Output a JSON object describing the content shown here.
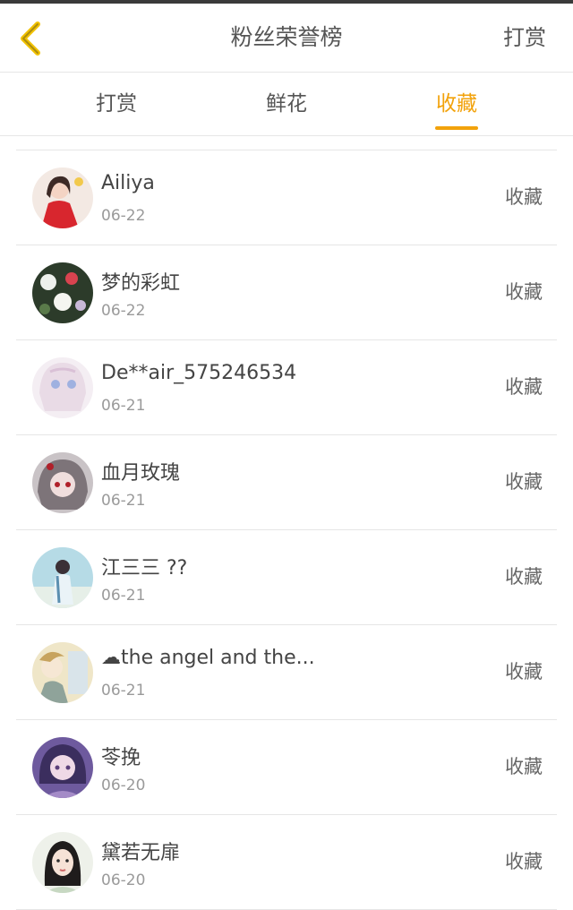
{
  "header": {
    "title": "粉丝荣誉榜",
    "action_label": "打赏",
    "back_icon": "chevron-left-icon",
    "back_color": "#f2c200"
  },
  "tabs": [
    {
      "label": "打赏",
      "active": false
    },
    {
      "label": "鲜花",
      "active": false
    },
    {
      "label": "收藏",
      "active": true
    }
  ],
  "accent_color": "#f2a20b",
  "fans": [
    {
      "name": "Ailiya",
      "date": "06-22",
      "action": "收藏"
    },
    {
      "name": "梦的彩虹",
      "date": "06-22",
      "action": "收藏"
    },
    {
      "name": "De**air_575246534",
      "date": "06-21",
      "action": "收藏"
    },
    {
      "name": "血月玫瑰",
      "date": "06-21",
      "action": "收藏"
    },
    {
      "name": "江三三 ??",
      "date": "06-21",
      "action": "收藏"
    },
    {
      "name": "☁the angel and the...",
      "date": "06-21",
      "action": "收藏"
    },
    {
      "name": "苓挽",
      "date": "06-20",
      "action": "收藏"
    },
    {
      "name": "黛若无扉",
      "date": "06-20",
      "action": "收藏"
    }
  ]
}
